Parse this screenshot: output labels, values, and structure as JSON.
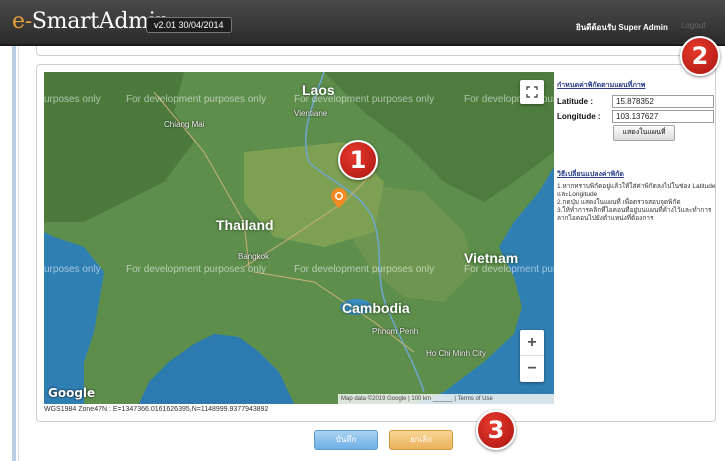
{
  "header": {
    "app_prefix": "e-",
    "app_name": "SmartAdmin",
    "version": "v2.01 30/04/2014",
    "user": "ยินดีต้อนรับ Super Admin",
    "logout": "Logout"
  },
  "map": {
    "dev_watermark": "For development purposes only",
    "dev_watermark_left": "urposes only",
    "labels": {
      "laos": "Laos",
      "thailand": "Thailand",
      "vietnam": "Vietnam",
      "cambodia": "Cambodia",
      "vientiane": "Vientiane",
      "bangkok": "Bangkok",
      "phnom_penh": "Phnom Penh",
      "ho_chi_minh": "Ho Chi Minh City",
      "chiang_mai": "Chiang Mai"
    },
    "attribution": "Map data ©2019 Google | 100 km ______ | Terms of Use",
    "google_logo": "Google",
    "zoom_in": "+",
    "zoom_out": "−",
    "marker_color": "#f08a24"
  },
  "coords_text": "WGS1984 Zone47N : E=1347366.0161626395,N=1148999.9377943892",
  "right_panel": {
    "title": "กำหนดค่าพิกัดตามแผนที่ภาพ",
    "latitude_label": "Latitude :",
    "latitude_value": "15.878352",
    "longitude_label": "Longitude :",
    "longitude_value": "103.137627",
    "show_map_button": "แสดงในแผนที่",
    "help_title": "วิธีเปลี่ยนแปลงค่าพิกัด",
    "help_lines": [
      "1.หากทราบพิกัดอยู่แล้วให้ใส่ค่าพิกัดลงไปในช่อง Latitude และLongitude",
      "2.กดปุ่ม แสดงในแผนที่ เพื่อตรวจสอบจุดพิกัด",
      "3.ให้ทำการคลิกที่ไอคอนที่อยู่บนแผนที่ค้างไว้และทำการลากไอคอนไปยังตำแหน่งที่ต้องการ"
    ]
  },
  "buttons": {
    "save": "บันทึก",
    "cancel": "ยกเลิก"
  },
  "callouts": [
    "1",
    "2",
    "3"
  ],
  "colors": {
    "callout": "#c62217",
    "save": "#7bb7e8",
    "cancel": "#f0bd6a",
    "header": "#333333",
    "water": "#2f7fb3",
    "land": "#5a8a4a"
  }
}
